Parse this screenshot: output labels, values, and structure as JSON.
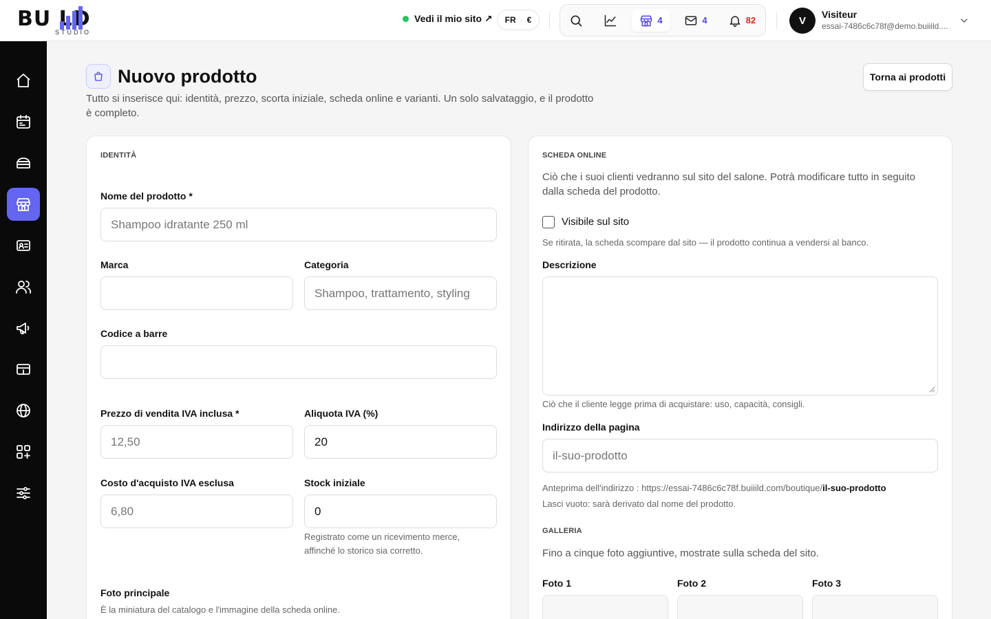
{
  "brand": {
    "logo_word": "BU  LD",
    "logo_sub": "STUDIO",
    "accent": "#6366f1"
  },
  "topbar": {
    "site_link": "Vedi il mio sito ↗",
    "lang": "FR",
    "currency": "€",
    "icons": [
      {
        "name": "search-icon",
        "count": ""
      },
      {
        "name": "chart-icon",
        "count": ""
      },
      {
        "name": "store-icon",
        "count": "4"
      },
      {
        "name": "mail-icon",
        "count": "4"
      },
      {
        "name": "bell-icon",
        "count": "82"
      }
    ],
    "user": {
      "initial": "V",
      "name": "Visiteur",
      "email": "essai-7486c6c78f@demo.buiiild...."
    }
  },
  "sidebar": {
    "items": [
      {
        "name": "home-icon",
        "active": false
      },
      {
        "name": "calendar-icon",
        "active": false
      },
      {
        "name": "services-icon",
        "active": false
      },
      {
        "name": "shop-icon",
        "active": true
      },
      {
        "name": "contact-card-icon",
        "active": false
      },
      {
        "name": "users-icon",
        "active": false
      },
      {
        "name": "megaphone-icon",
        "active": false
      },
      {
        "name": "payment-icon",
        "active": false
      },
      {
        "name": "globe-icon",
        "active": false
      },
      {
        "name": "apps-icon",
        "active": false
      },
      {
        "name": "settings-sliders-icon",
        "active": false
      }
    ]
  },
  "header": {
    "title": "Nuovo prodotto",
    "subtitle": "Tutto si inserisce qui: identità, prezzo, scorta iniziale, scheda online e varianti. Un solo salvataggio, e il prodotto è completo.",
    "back_button": "Torna ai prodotti"
  },
  "identity": {
    "section": "IDENTITÀ",
    "name_label": "Nome del prodotto *",
    "name_placeholder": "Shampoo idratante 250 ml",
    "brand_label": "Marca",
    "brand_value": "",
    "category_label": "Categoria",
    "category_placeholder": "Shampoo, trattamento, styling",
    "barcode_label": "Codice a barre",
    "barcode_value": "",
    "price_label": "Prezzo di vendita IVA inclusa *",
    "price_placeholder": "12,50",
    "vat_label": "Aliquota IVA (%)",
    "vat_value": "20",
    "cost_label": "Costo d'acquisto IVA esclusa",
    "cost_placeholder": "6,80",
    "stock_label": "Stock iniziale",
    "stock_value": "0",
    "stock_help": "Registrato come un ricevimento merce, affinché lo storico sia corretto.",
    "photo_label": "Foto principale",
    "photo_help": "È la miniatura del catalogo e l'immagine della scheda online."
  },
  "online": {
    "section": "SCHEDA ONLINE",
    "intro": "Ciò che i suoi clienti vedranno sul sito del salone. Potrà modificare tutto in seguito dalla scheda del prodotto.",
    "visible_label": "Visibile sul sito",
    "visible_checked": false,
    "visible_help": "Se ritirata, la scheda scompare dal sito — il prodotto continua a vendersi al banco.",
    "description_label": "Descrizione",
    "description_value": "",
    "description_help": "Ciò che il cliente legge prima di acquistare: uso, capacità, consigli.",
    "address_label": "Indirizzo della pagina",
    "address_placeholder": "il-suo-prodotto",
    "preview_prefix": "Anteprima dell'indirizzo : https://essai-7486c6c78f.buiiild.com/boutique/",
    "preview_slug": "il-suo-prodotto",
    "address_help": "Lasci vuoto: sarà derivato dal nome del prodotto.",
    "gallery_section": "GALLERIA",
    "gallery_intro": "Fino a cinque foto aggiuntive, mostrate sulla scheda del sito.",
    "photos": [
      "Foto 1",
      "Foto 2",
      "Foto 3"
    ]
  }
}
